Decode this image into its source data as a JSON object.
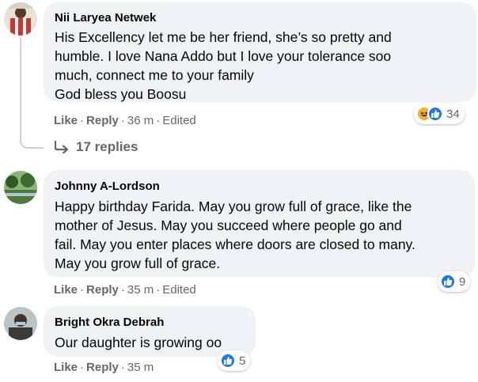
{
  "comments": [
    {
      "author": "Nii Laryea Netwek",
      "lines": [
        "His Excellency let me be her friend, she’s so pretty and",
        "humble. I love Nana Addo but I love your tolerance soo",
        "much, connect me to your family",
        "God bless you Boosu"
      ],
      "like": "Like",
      "reply": "Reply",
      "time": "36 m",
      "edited": "Edited",
      "reaction_count": "34",
      "reaction_icons": [
        "haha-icon",
        "like-icon"
      ]
    },
    {
      "author": "Johnny A-Lordson",
      "lines": [
        "Happy birthday Farida. May you grow full of grace, like the",
        "mother of Jesus. May you succeed where people go and",
        "fail. May you enter places where doors are closed to many.",
        "May you grow full of grace."
      ],
      "like": "Like",
      "reply": "Reply",
      "time": "35 m",
      "edited": "Edited",
      "reaction_count": "9",
      "reaction_icons": [
        "like-icon"
      ]
    },
    {
      "author": "Bright Okra Debrah",
      "lines": [
        "Our daughter is growing oo"
      ],
      "like": "Like",
      "reply": "Reply",
      "time": "35 m",
      "reaction_count": "5",
      "reaction_icons": [
        "like-icon"
      ]
    }
  ],
  "replies_link": "17 replies",
  "colors": {
    "bubble": "#f0f2f5",
    "meta_text": "#65676b",
    "like_blue": "#1877f2",
    "haha_yellow": "#f7b125"
  }
}
